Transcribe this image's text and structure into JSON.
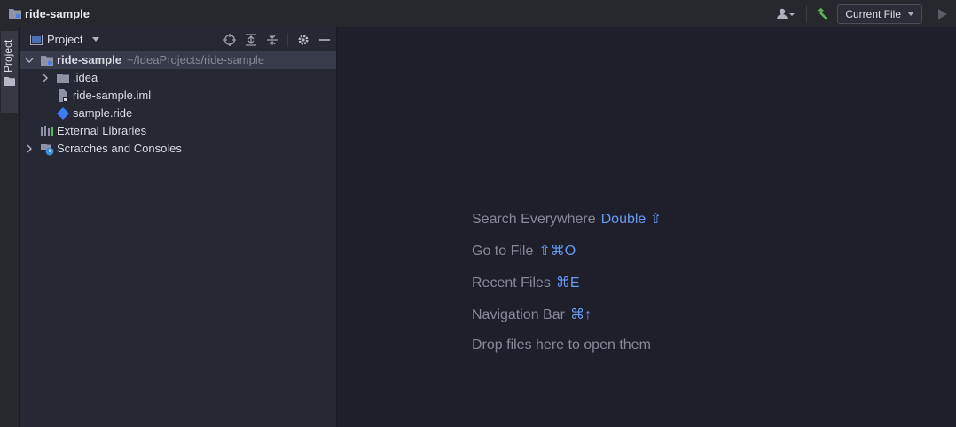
{
  "titlebar": {
    "project_name": "ride-sample",
    "run_config": "Current File"
  },
  "strip": {
    "tab_label": "Project"
  },
  "panel": {
    "title": "Project",
    "tree": [
      {
        "label": "ride-sample",
        "path": "~/IdeaProjects/ride-sample"
      },
      {
        "label": ".idea"
      },
      {
        "label": "ride-sample.iml"
      },
      {
        "label": "sample.ride"
      },
      {
        "label": "External Libraries"
      },
      {
        "label": "Scratches and Consoles"
      }
    ]
  },
  "editor": {
    "hints": [
      {
        "text": "Search Everywhere",
        "key": "Double ⇧"
      },
      {
        "text": "Go to File",
        "key": "⇧⌘O"
      },
      {
        "text": "Recent Files",
        "key": "⌘E"
      },
      {
        "text": "Navigation Bar",
        "key": "⌘↑"
      },
      {
        "text": "Drop files here to open them",
        "key": ""
      }
    ]
  },
  "colors": {
    "accent": "#6a9af0",
    "hammer": "#5fb35f",
    "sample_ride_icon": "#3f7bf4",
    "scratch_badge": "#3b8fe0"
  },
  "icons": [
    "folder-module-icon",
    "user-icon",
    "hammer-icon",
    "run-icon",
    "locate-icon",
    "expand-all-icon",
    "collapse-all-icon",
    "gear-icon",
    "hide-icon"
  ]
}
